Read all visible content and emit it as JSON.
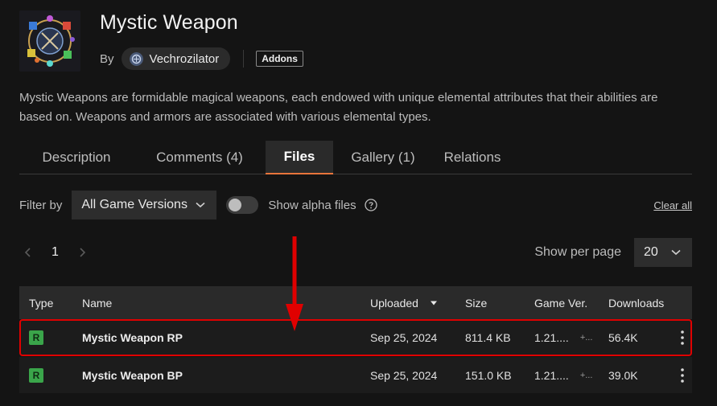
{
  "project": {
    "title": "Mystic Weapon",
    "by_label": "By",
    "author": "Vechrozilator",
    "category_tag": "Addons",
    "description": "Mystic Weapons are formidable magical weapons, each endowed with unique elemental attributes that their abilities are based on. Weapons and armors are associated with various elemental types."
  },
  "tabs": [
    {
      "label": "Description",
      "active": false
    },
    {
      "label": "Comments (4)",
      "active": false
    },
    {
      "label": "Files",
      "active": true
    },
    {
      "label": "Gallery (1)",
      "active": false
    },
    {
      "label": "Relations",
      "active": false
    }
  ],
  "filters": {
    "filter_by_label": "Filter by",
    "game_version_select": "All Game Versions",
    "show_alpha_label": "Show alpha files",
    "show_alpha_enabled": false,
    "clear_all": "Clear all"
  },
  "pagination": {
    "current_page": "1",
    "per_page_label": "Show per page",
    "per_page_value": "20"
  },
  "table": {
    "headers": {
      "type": "Type",
      "name": "Name",
      "uploaded": "Uploaded",
      "size": "Size",
      "game_ver": "Game Ver.",
      "downloads": "Downloads"
    },
    "rows": [
      {
        "type": "R",
        "name": "Mystic Weapon RP",
        "uploaded": "Sep 25, 2024",
        "size": "811.4 KB",
        "game_ver": "1.21....",
        "game_ver_more": "+...",
        "downloads": "56.4K",
        "highlighted": true
      },
      {
        "type": "R",
        "name": "Mystic Weapon BP",
        "uploaded": "Sep 25, 2024",
        "size": "151.0 KB",
        "game_ver": "1.21....",
        "game_ver_more": "+...",
        "downloads": "39.0K",
        "highlighted": false
      }
    ]
  },
  "colors": {
    "accent_tab_underline": "#e8743b",
    "release_badge": "#3aa54a",
    "annotation_red": "#e00000",
    "background": "#141414"
  },
  "icons": {
    "author_avatar": "author-avatar-icon",
    "chevron": "chevron-down-icon",
    "help": "question-circle-icon",
    "prev": "chevron-left-icon",
    "next": "chevron-right-icon",
    "sort": "sort-desc-icon",
    "menu": "kebab-menu-icon",
    "annotation": "red-arrow-annotation"
  }
}
